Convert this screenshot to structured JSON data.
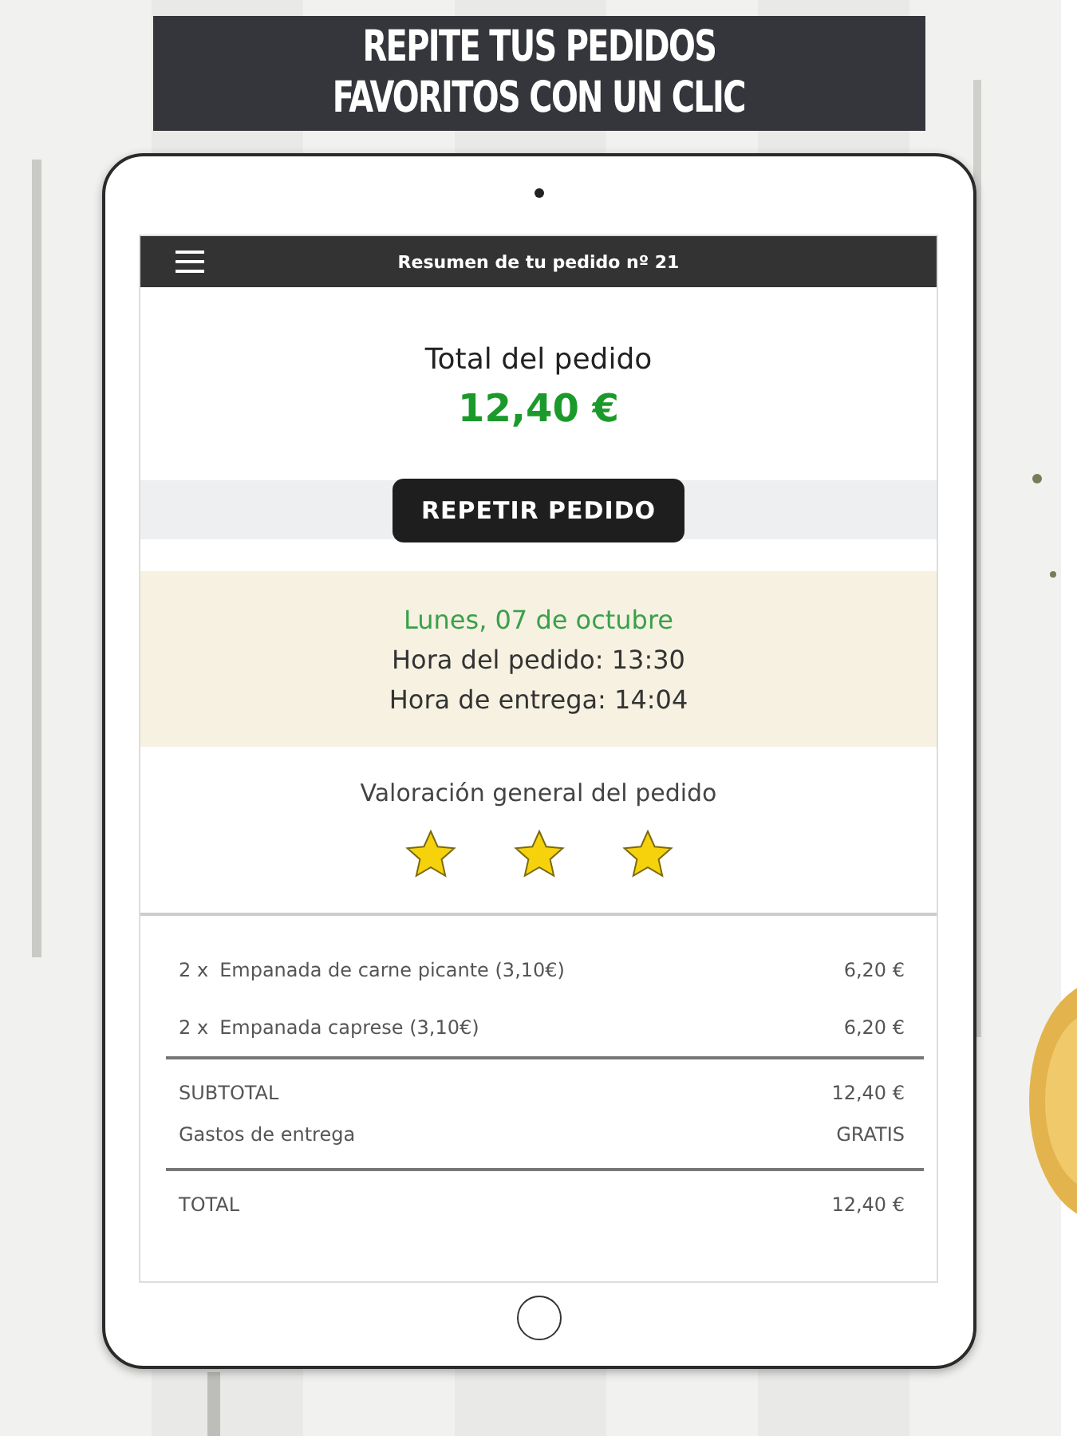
{
  "banner": {
    "lines": [
      "REPITE TUS PEDIDOS",
      "FAVORITOS CON UN CLIC"
    ]
  },
  "app_bar": {
    "title": "Resumen de tu pedido nº 21"
  },
  "summary": {
    "label": "Total del pedido",
    "amount": "12,40 €",
    "button": "REPETIR PEDIDO"
  },
  "schedule": {
    "date": "Lunes, 07 de octubre",
    "order_time": "Hora del pedido: 13:30",
    "delivery_time": "Hora de entrega: 14:04"
  },
  "rating": {
    "label": "Valoración general del pedido",
    "stars": 3
  },
  "items": [
    {
      "quantity": "2 x",
      "name": "Empanada de carne picante (3,10€)",
      "price": "6,20 €"
    },
    {
      "quantity": "2 x",
      "name": "Empanada caprese (3,10€)",
      "price": "6,20 €"
    }
  ],
  "subtotals": [
    {
      "label": "SUBTOTAL",
      "value": "12,40 €"
    },
    {
      "label": "Gastos de entrega",
      "value": "GRATIS"
    }
  ],
  "total": {
    "label": "TOTAL",
    "value": "12,40 €"
  }
}
